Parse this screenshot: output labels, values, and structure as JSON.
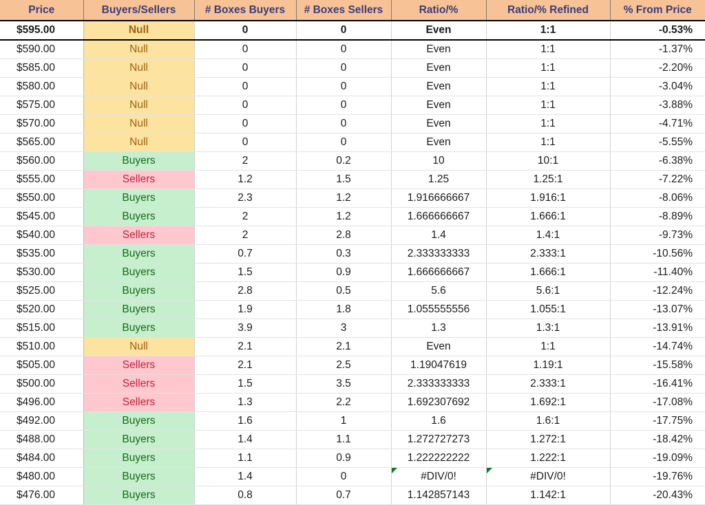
{
  "table": {
    "columns": [
      {
        "key": "price",
        "label": "Price"
      },
      {
        "key": "side",
        "label": "Buyers/Sellers"
      },
      {
        "key": "boxbuy",
        "label": "# Boxes Buyers"
      },
      {
        "key": "boxsell",
        "label": "# Boxes Sellers"
      },
      {
        "key": "ratio",
        "label": "Ratio/%"
      },
      {
        "key": "ratioref",
        "label": "Ratio/% Refined"
      },
      {
        "key": "frompx",
        "label": "% From Price"
      }
    ],
    "colors": {
      "header_bg": "#F7C396",
      "header_text": "#3B3B7A",
      "null_bg": "#FCE3A0",
      "null_text": "#9C6215",
      "buyers_bg": "#C6EFCE",
      "buyers_text": "#186818",
      "sellers_bg": "#FFC7CE",
      "sellers_text": "#C0223B",
      "error_marker": "#0E7B27"
    },
    "rows": [
      {
        "price": "$595.00",
        "side": "Null",
        "boxbuy": "0",
        "boxsell": "0",
        "ratio": "Even",
        "ratioref": "1:1",
        "frompx": "-0.53%",
        "highlight": true
      },
      {
        "price": "$590.00",
        "side": "Null",
        "boxbuy": "0",
        "boxsell": "0",
        "ratio": "Even",
        "ratioref": "1:1",
        "frompx": "-1.37%"
      },
      {
        "price": "$585.00",
        "side": "Null",
        "boxbuy": "0",
        "boxsell": "0",
        "ratio": "Even",
        "ratioref": "1:1",
        "frompx": "-2.20%"
      },
      {
        "price": "$580.00",
        "side": "Null",
        "boxbuy": "0",
        "boxsell": "0",
        "ratio": "Even",
        "ratioref": "1:1",
        "frompx": "-3.04%"
      },
      {
        "price": "$575.00",
        "side": "Null",
        "boxbuy": "0",
        "boxsell": "0",
        "ratio": "Even",
        "ratioref": "1:1",
        "frompx": "-3.88%"
      },
      {
        "price": "$570.00",
        "side": "Null",
        "boxbuy": "0",
        "boxsell": "0",
        "ratio": "Even",
        "ratioref": "1:1",
        "frompx": "-4.71%"
      },
      {
        "price": "$565.00",
        "side": "Null",
        "boxbuy": "0",
        "boxsell": "0",
        "ratio": "Even",
        "ratioref": "1:1",
        "frompx": "-5.55%"
      },
      {
        "price": "$560.00",
        "side": "Buyers",
        "boxbuy": "2",
        "boxsell": "0.2",
        "ratio": "10",
        "ratioref": "10:1",
        "frompx": "-6.38%"
      },
      {
        "price": "$555.00",
        "side": "Sellers",
        "boxbuy": "1.2",
        "boxsell": "1.5",
        "ratio": "1.25",
        "ratioref": "1.25:1",
        "frompx": "-7.22%"
      },
      {
        "price": "$550.00",
        "side": "Buyers",
        "boxbuy": "2.3",
        "boxsell": "1.2",
        "ratio": "1.916666667",
        "ratioref": "1.916:1",
        "frompx": "-8.06%"
      },
      {
        "price": "$545.00",
        "side": "Buyers",
        "boxbuy": "2",
        "boxsell": "1.2",
        "ratio": "1.666666667",
        "ratioref": "1.666:1",
        "frompx": "-8.89%"
      },
      {
        "price": "$540.00",
        "side": "Sellers",
        "boxbuy": "2",
        "boxsell": "2.8",
        "ratio": "1.4",
        "ratioref": "1.4:1",
        "frompx": "-9.73%"
      },
      {
        "price": "$535.00",
        "side": "Buyers",
        "boxbuy": "0.7",
        "boxsell": "0.3",
        "ratio": "2.333333333",
        "ratioref": "2.333:1",
        "frompx": "-10.56%"
      },
      {
        "price": "$530.00",
        "side": "Buyers",
        "boxbuy": "1.5",
        "boxsell": "0.9",
        "ratio": "1.666666667",
        "ratioref": "1.666:1",
        "frompx": "-11.40%"
      },
      {
        "price": "$525.00",
        "side": "Buyers",
        "boxbuy": "2.8",
        "boxsell": "0.5",
        "ratio": "5.6",
        "ratioref": "5.6:1",
        "frompx": "-12.24%"
      },
      {
        "price": "$520.00",
        "side": "Buyers",
        "boxbuy": "1.9",
        "boxsell": "1.8",
        "ratio": "1.055555556",
        "ratioref": "1.055:1",
        "frompx": "-13.07%"
      },
      {
        "price": "$515.00",
        "side": "Buyers",
        "boxbuy": "3.9",
        "boxsell": "3",
        "ratio": "1.3",
        "ratioref": "1.3:1",
        "frompx": "-13.91%"
      },
      {
        "price": "$510.00",
        "side": "Null",
        "boxbuy": "2.1",
        "boxsell": "2.1",
        "ratio": "Even",
        "ratioref": "1:1",
        "frompx": "-14.74%"
      },
      {
        "price": "$505.00",
        "side": "Sellers",
        "boxbuy": "2.1",
        "boxsell": "2.5",
        "ratio": "1.19047619",
        "ratioref": "1.19:1",
        "frompx": "-15.58%"
      },
      {
        "price": "$500.00",
        "side": "Sellers",
        "boxbuy": "1.5",
        "boxsell": "3.5",
        "ratio": "2.333333333",
        "ratioref": "2.333:1",
        "frompx": "-16.41%"
      },
      {
        "price": "$496.00",
        "side": "Sellers",
        "boxbuy": "1.3",
        "boxsell": "2.2",
        "ratio": "1.692307692",
        "ratioref": "1.692:1",
        "frompx": "-17.08%"
      },
      {
        "price": "$492.00",
        "side": "Buyers",
        "boxbuy": "1.6",
        "boxsell": "1",
        "ratio": "1.6",
        "ratioref": "1.6:1",
        "frompx": "-17.75%"
      },
      {
        "price": "$488.00",
        "side": "Buyers",
        "boxbuy": "1.4",
        "boxsell": "1.1",
        "ratio": "1.272727273",
        "ratioref": "1.272:1",
        "frompx": "-18.42%"
      },
      {
        "price": "$484.00",
        "side": "Buyers",
        "boxbuy": "1.1",
        "boxsell": "0.9",
        "ratio": "1.222222222",
        "ratioref": "1.222:1",
        "frompx": "-19.09%"
      },
      {
        "price": "$480.00",
        "side": "Buyers",
        "boxbuy": "1.4",
        "boxsell": "0",
        "ratio": "#DIV/0!",
        "ratioref": "#DIV/0!",
        "frompx": "-19.76%",
        "ratio_error": true,
        "ratioref_error": true
      },
      {
        "price": "$476.00",
        "side": "Buyers",
        "boxbuy": "0.8",
        "boxsell": "0.7",
        "ratio": "1.142857143",
        "ratioref": "1.142:1",
        "frompx": "-20.43%"
      }
    ]
  }
}
